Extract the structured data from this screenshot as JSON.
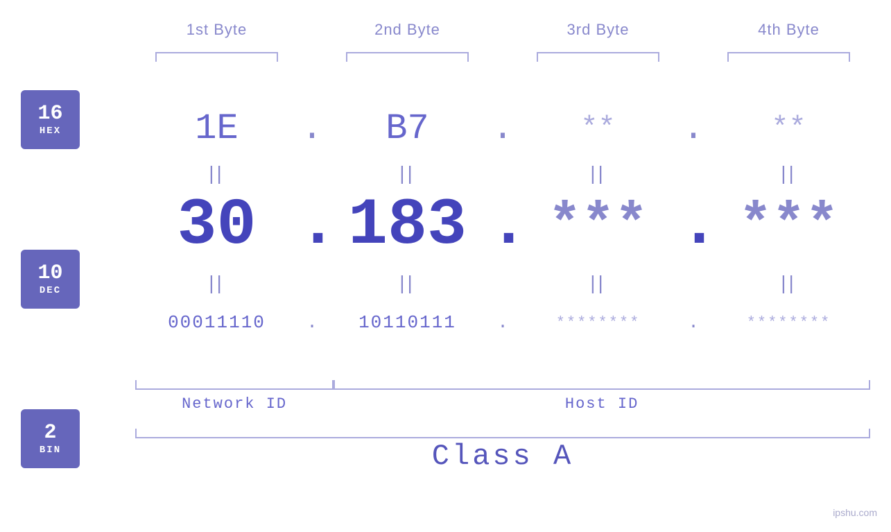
{
  "byteHeaders": {
    "b1": "1st Byte",
    "b2": "2nd Byte",
    "b3": "3rd Byte",
    "b4": "4th Byte"
  },
  "badges": {
    "hex": {
      "num": "16",
      "label": "HEX"
    },
    "dec": {
      "num": "10",
      "label": "DEC"
    },
    "bin": {
      "num": "2",
      "label": "BIN"
    }
  },
  "hexRow": {
    "b1": "1E",
    "dot1": ".",
    "b2": "B7",
    "dot2": ".",
    "b3": "**",
    "dot3": ".",
    "b4": "**"
  },
  "decRow": {
    "b1": "30",
    "dot1": ".",
    "b2": "183",
    "dot2": ".",
    "b3": "***",
    "dot3": ".",
    "b4": "***"
  },
  "binRow": {
    "b1": "00011110",
    "dot1": ".",
    "b2": "10110111",
    "dot2": ".",
    "b3": "********",
    "dot3": ".",
    "b4": "********"
  },
  "labels": {
    "networkId": "Network ID",
    "hostId": "Host ID",
    "classA": "Class A"
  },
  "watermark": "ipshu.com",
  "equals": "||"
}
